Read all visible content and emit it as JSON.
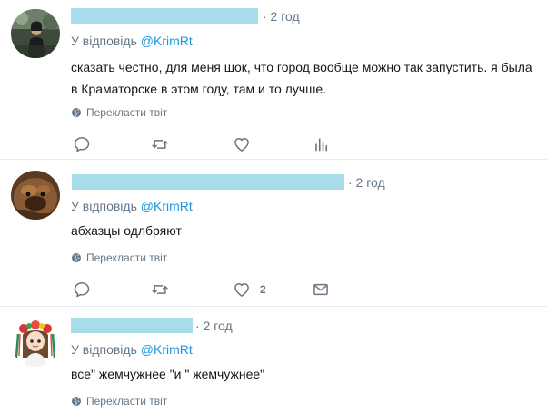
{
  "colors": {
    "link": "#1b95e0",
    "muted": "#657786",
    "text": "#14171a",
    "redaction": "#a8dcea",
    "divider": "#e6ecf0"
  },
  "tweets": [
    {
      "time": "· 2 год",
      "reply_prefix": "У відповідь ",
      "reply_handle": "@KrimRt",
      "text": "сказать честно, для меня шок, что город вообще можно так запустить. я была в Краматорске в этом году, там и то лучше.",
      "translate": "Перекласти твіт",
      "actions": [
        "reply-icon",
        "retweet-icon",
        "like-icon",
        "analytics-icon"
      ]
    },
    {
      "time": "· 2 год",
      "reply_prefix": "У відповідь ",
      "reply_handle": "@KrimRt",
      "text": "абхазцы одлбряют",
      "translate": "Перекласти твіт",
      "like_count": "2",
      "actions": [
        "reply-icon",
        "retweet-icon",
        "like-icon",
        "message-icon"
      ]
    },
    {
      "time": "· 2 год",
      "reply_prefix": "У відповідь ",
      "reply_handle": "@KrimRt",
      "text": "все\" жемчужнее \"и \" жемчужнее\"",
      "translate": "Перекласти твіт"
    }
  ]
}
